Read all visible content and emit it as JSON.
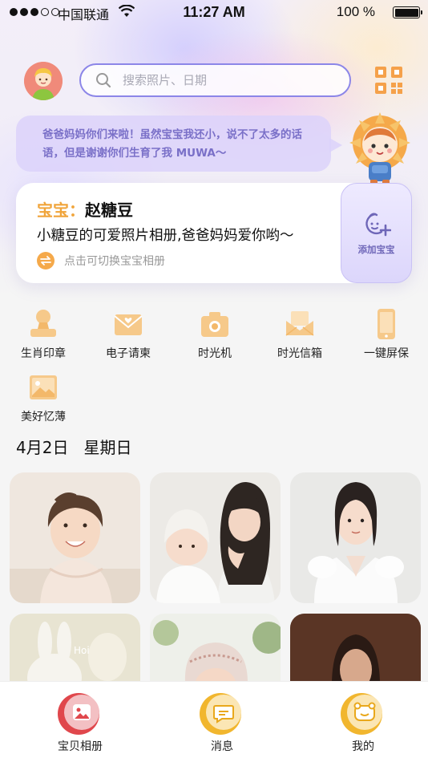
{
  "status_bar": {
    "carrier": "中国联通",
    "time": "11:27 AM",
    "battery_pct": "100 %"
  },
  "header": {
    "search_placeholder": "搜索照片、日期",
    "avatar_icon": "baby-avatar-icon",
    "qr_icon": "qr-code-icon"
  },
  "bubble": {
    "message": "爸爸妈妈你们来啦！虽然宝宝我还小，说不了太多的话语，但是谢谢你们生育了我 MUWA～"
  },
  "baby_card": {
    "label": "宝宝：",
    "name": "赵糖豆",
    "description": "小糖豆的可爱照片相册,爸爸妈妈爱你哟～",
    "switch_hint": "点击可切换宝宝相册",
    "add_label": "添加宝宝"
  },
  "features": [
    {
      "label": "生肖印章",
      "icon": "stamp-icon"
    },
    {
      "label": "电子请柬",
      "icon": "invitation-icon"
    },
    {
      "label": "时光机",
      "icon": "camera-icon"
    },
    {
      "label": "时光信箱",
      "icon": "mailbox-icon"
    },
    {
      "label": "一键屏保",
      "icon": "phone-icon"
    },
    {
      "label": "美好忆薄",
      "icon": "album-icon"
    }
  ],
  "date_section": {
    "date": "4月2日",
    "weekday": "星期日"
  },
  "tabs": [
    {
      "label": "宝贝相册",
      "icon": "photo-album-icon",
      "active": true
    },
    {
      "label": "消息",
      "icon": "message-icon",
      "active": false
    },
    {
      "label": "我的",
      "icon": "profile-icon",
      "active": false
    }
  ],
  "colors": {
    "accent_purple": "#8c86e8",
    "accent_orange": "#f0a43a",
    "active_tab": "#e0474c"
  }
}
